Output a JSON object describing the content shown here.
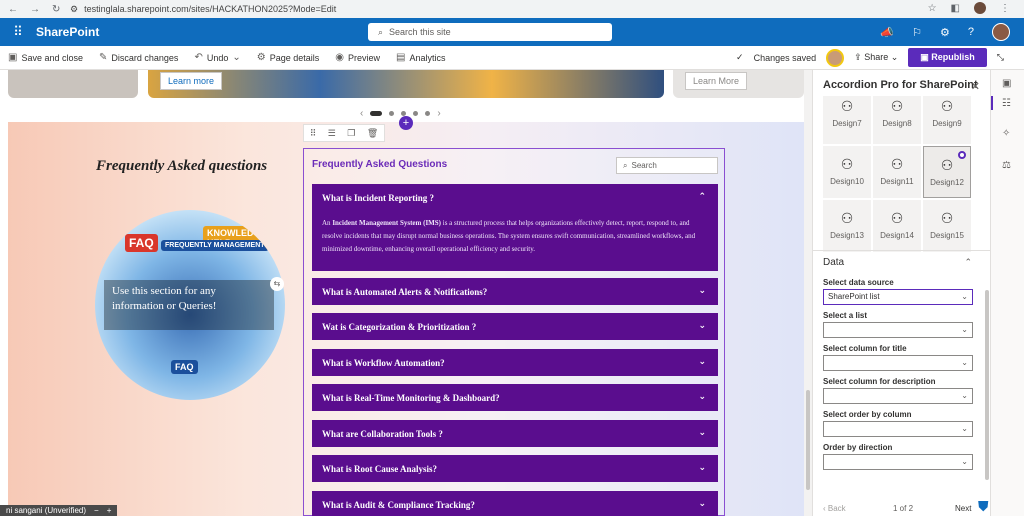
{
  "browser": {
    "url": "testinglala.sharepoint.com/sites/HACKATHON2025?Mode=Edit"
  },
  "suite": {
    "brand": "SharePoint",
    "search_placeholder": "Search this site"
  },
  "commands": {
    "save_close": "Save and close",
    "discard": "Discard changes",
    "undo": "Undo",
    "page_details": "Page details",
    "preview": "Preview",
    "analytics": "Analytics",
    "changes_saved": "Changes saved",
    "share": "Share",
    "republish": "Republish"
  },
  "hero": {
    "learn_more_1": "Learn more",
    "learn_more_2": "Learn More"
  },
  "section": {
    "left_title": "Frequently Asked questions",
    "overlay_text": "Use this section for any information or Queries!",
    "image_badges": [
      "FAQ",
      "KNOWLEDGE HELP",
      "FREQUENTLY MANAGEMENT",
      "FAQ"
    ]
  },
  "faq": {
    "title": "Frequently Asked Questions",
    "search_placeholder": "Search",
    "items": [
      {
        "q": "What is Incident Reporting ?",
        "a_bold": "Incident Management System (IMS)",
        "a_pre": "An ",
        "a_post": " is a structured process that helps organizations effectively detect, report, respond to, and resolve incidents that may disrupt normal business operations. The system ensures swift communication, streamlined workflows, and minimized downtime, enhancing overall operational efficiency and security."
      },
      {
        "q": "What is Automated Alerts & Notifications?"
      },
      {
        "q": "Wat is Categorization & Prioritization ?"
      },
      {
        "q": "What is Workflow Automation?"
      },
      {
        "q": "What is Real-Time Monitoring & Dashboard?"
      },
      {
        "q": "What are Collaboration Tools ?"
      },
      {
        "q": "What is Root Cause Analysis?"
      },
      {
        "q": "What is Audit & Compliance Tracking?"
      }
    ]
  },
  "pane": {
    "title": "Accordion Pro for SharePoint",
    "designs": [
      "Design7",
      "Design8",
      "Design9",
      "Design10",
      "Design11",
      "Design12",
      "Design13",
      "Design14",
      "Design15"
    ],
    "selected_design": "Design12",
    "data_header": "Data",
    "fields": [
      {
        "label": "Select data source",
        "value": "SharePoint list"
      },
      {
        "label": "Select a list",
        "value": ""
      },
      {
        "label": "Select column for title",
        "value": ""
      },
      {
        "label": "Select column for description",
        "value": ""
      },
      {
        "label": "Select order by column",
        "value": ""
      },
      {
        "label": "Order by direction",
        "value": ""
      }
    ],
    "pager": {
      "back": "Back",
      "count": "1 of 2",
      "next": "Next"
    }
  },
  "user_tag": "ni sangani (Unverified)"
}
